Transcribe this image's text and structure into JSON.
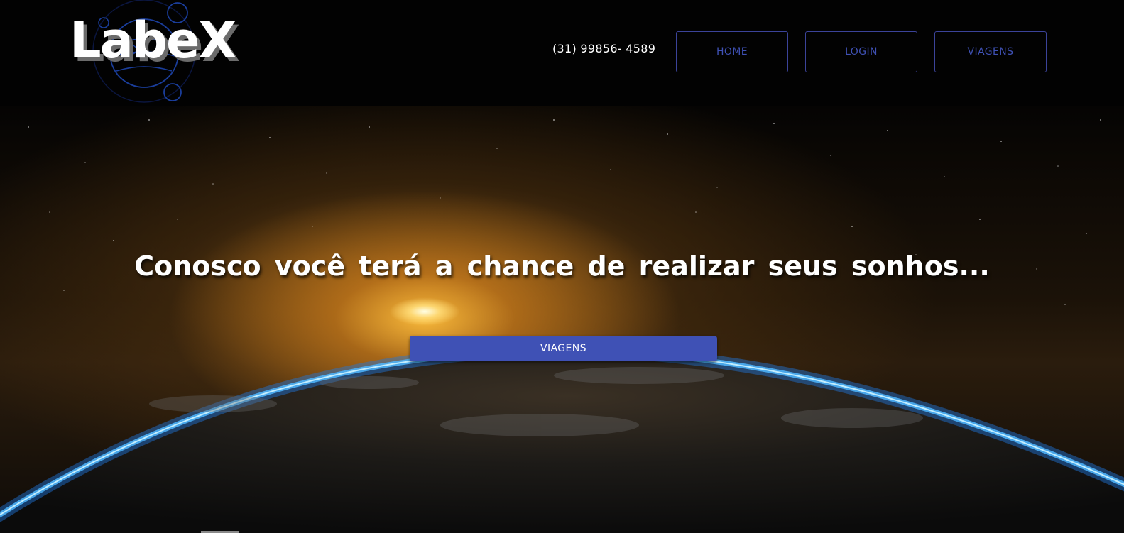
{
  "header": {
    "logo_text": "LabeX",
    "phone": "(31) 99856- 4589",
    "nav": {
      "home_label": "HOME",
      "login_label": "LOGIN",
      "viagens_label": "VIAGENS"
    }
  },
  "hero": {
    "title": "Conosco você terá a chance de realizar seus sonhos...",
    "cta_label": "VIAGENS"
  },
  "colors": {
    "accent": "#3f51b5",
    "header_bg": "#020202",
    "nav_border": "#3b4399",
    "text_light": "#ffffff"
  },
  "icons": {
    "logo_planet": "planet-icon"
  }
}
